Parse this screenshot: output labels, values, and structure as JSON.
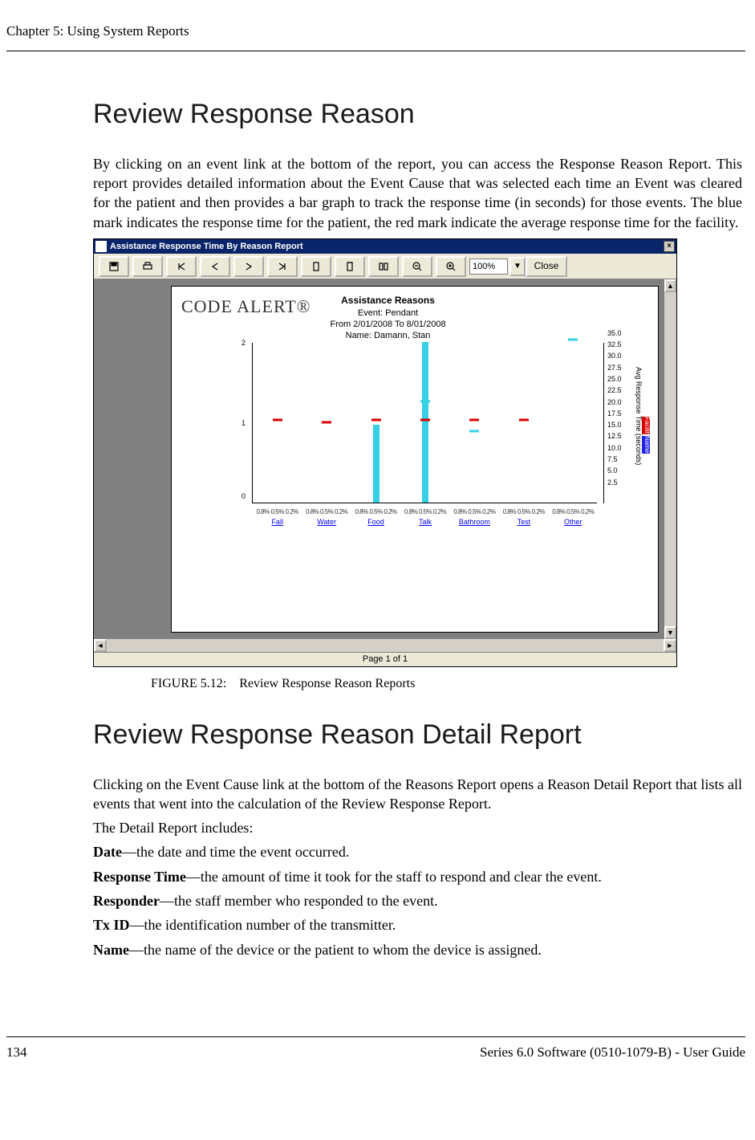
{
  "doc": {
    "chapter_header": "Chapter 5: Using System Reports",
    "section1_title": "Review Response Reason",
    "section1_body": "By clicking on an event link at the bottom of the report, you can access the Response Reason Report. This report provides detailed information about the Event Cause that was selected each time an Event was cleared for the patient and then provides a bar graph to track the response time (in seconds) for those events. The blue mark indicates the response time for the patient, the red mark indicate the average response time for the facility.",
    "figure_caption_num": "FIGURE 5.12:",
    "figure_caption": "Review Response Reason Reports",
    "section2_title": "Review Response Reason Detail Report",
    "section2_body1": "Clicking on the Event Cause link at the bottom of the Reasons Report opens a Reason Detail Report that lists all events that went into the calculation of the Review Response Report.",
    "section2_body2": "The Detail Report includes:",
    "defs": [
      {
        "term": "Date",
        "desc": "—the date and time the event occurred."
      },
      {
        "term": "Response Time",
        "desc": "—the amount of time it took for the staff to respond and clear the event."
      },
      {
        "term": "Responder",
        "desc": "—the staff member who responded to the event."
      },
      {
        "term": "Tx ID",
        "desc": "—the identification number of the transmitter."
      },
      {
        "term": "Name",
        "desc": "—the name of the device or the patient to whom the device is assigned."
      }
    ],
    "page_number": "134",
    "product_footer": "Series 6.0 Software (0510-1079-B) - User Guide"
  },
  "report": {
    "window_title": "Assistance Response Time By Reason Report",
    "toolbar": {
      "save": "save",
      "print": "print",
      "first": "first",
      "prev": "prev",
      "next": "next",
      "last": "last",
      "page": "page",
      "top": "top",
      "bottom": "bottom",
      "zoom_out": "zoom-out",
      "zoom_in": "zoom-in",
      "zoom_value": "100%",
      "close_label": "Close"
    },
    "page_footer_text": "Page 1 of 1",
    "brand": "CODE ALERT®",
    "header_title": "Assistance Reasons",
    "header_event": "Event: Pendant",
    "header_range": "From 2/01/2008 To 8/01/2008",
    "header_name": "Name: Damann, Stan",
    "legend": {
      "facility": "Facility",
      "name": "Name"
    },
    "axis_title": "Avg Response Time (seconds)"
  },
  "chart_data": {
    "type": "bar",
    "title": "Assistance Reasons",
    "ylabel_left_ticks": [
      0,
      1,
      2
    ],
    "ylabel_right": "Avg Response Time (seconds)",
    "ylim_right": [
      0,
      35
    ],
    "right_ticks": [
      2.5,
      5.0,
      7.5,
      10.0,
      12.5,
      15.0,
      17.5,
      20.0,
      22.5,
      25.0,
      27.5,
      30.0,
      32.5,
      35.0
    ],
    "categories": [
      "Fall",
      "Water",
      "Food",
      "Talk",
      "Bathroom",
      "Test",
      "Other"
    ],
    "series": [
      {
        "name": "Name (blue bar height)",
        "values": [
          0,
          0,
          17,
          35,
          0,
          0,
          0
        ]
      },
      {
        "name": "Name blue marks",
        "values": [
          null,
          null,
          17.5,
          21.5,
          15,
          null,
          35
        ]
      },
      {
        "name": "Facility red marks",
        "values": [
          17.5,
          17,
          17.5,
          17.5,
          17.5,
          17.5,
          null
        ]
      }
    ],
    "bottom_percent_row": "0.8% 0.5% 0.2%"
  }
}
